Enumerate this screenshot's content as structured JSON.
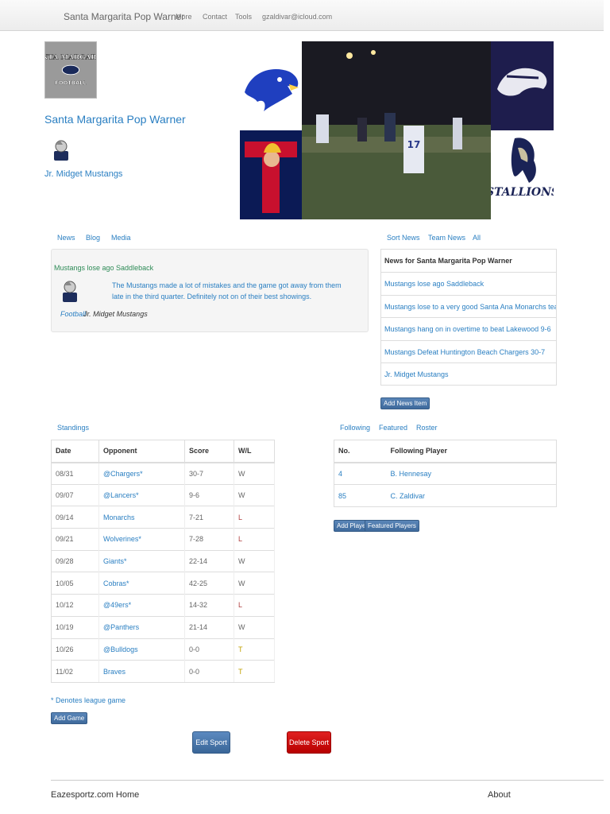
{
  "nav": {
    "brand": "Santa Margarita Pop Warner",
    "items": [
      "More",
      "Contact",
      "Tools",
      "gzaldivar@icloud.com"
    ]
  },
  "header": {
    "logo_text": "SANTA MARGARITA",
    "logo_sub": "FOOTBALL",
    "title": "Santa Margarita Pop Warner",
    "division": "Jr. Midget Mustangs",
    "collage_labels": {
      "stallions": "STALLIONS"
    }
  },
  "left_tabs": [
    "News",
    "Blog",
    "Media"
  ],
  "featured_news": {
    "headline": "Mustangs lose ago Saddleback",
    "body": "The Mustangs made a lot of mistakes and the game got away from them late in the third quarter. Definitely not on of their best showings.",
    "sport_tag": "Football",
    "team_tag": "Jr. Midget Mustangs"
  },
  "right_tabs": [
    "Sort News",
    "Team News",
    "All"
  ],
  "news_list": {
    "header": "News for Santa Margarita Pop Warner",
    "items": [
      "Mustangs lose ago Saddleback",
      "Mustangs lose to a very good Santa Ana Monarchs team",
      "Mustangs hang on in overtime to beat Lakewood 9-6",
      "Mustangs Defeat Huntington Beach Chargers 30-7",
      "Jr. Midget Mustangs"
    ],
    "add_button": "Add News Item"
  },
  "standings": {
    "tab": "Standings",
    "columns": [
      "Date",
      "Opponent",
      "Score",
      "W/L"
    ],
    "rows": [
      [
        "08/31",
        "@Chargers*",
        "30-7",
        "W"
      ],
      [
        "09/07",
        "@Lancers*",
        "9-6",
        "W"
      ],
      [
        "09/14",
        "Monarchs",
        "7-21",
        "L"
      ],
      [
        "09/21",
        "Wolverines*",
        "7-28",
        "L"
      ],
      [
        "09/28",
        "Giants*",
        "22-14",
        "W"
      ],
      [
        "10/05",
        "Cobras*",
        "42-25",
        "W"
      ],
      [
        "10/12",
        "@49ers*",
        "14-32",
        "L"
      ],
      [
        "10/19",
        "@Panthers",
        "21-14",
        "W"
      ],
      [
        "10/26",
        "@Bulldogs",
        "0-0",
        "T"
      ],
      [
        "11/02",
        "Braves",
        "0-0",
        "T"
      ]
    ],
    "note": "* Denotes league game",
    "add_button": "Add Game"
  },
  "following": {
    "tabs": [
      "Following",
      "Featured",
      "Roster"
    ],
    "columns": [
      "No.",
      "Following Player"
    ],
    "rows": [
      [
        "4",
        "B. Hennesay"
      ],
      [
        "85",
        "C. Zaldivar"
      ]
    ],
    "add_player": "Add Player",
    "featured_players": "Featured Players"
  },
  "actions": {
    "edit": "Edit Sport",
    "delete": "Delete Sport"
  },
  "footer": {
    "home": "Eazesportz.com Home",
    "about": "About"
  },
  "colors": {
    "link": "#2a7fc2",
    "delete": "#cc0000",
    "primary": "#4a78ae"
  }
}
